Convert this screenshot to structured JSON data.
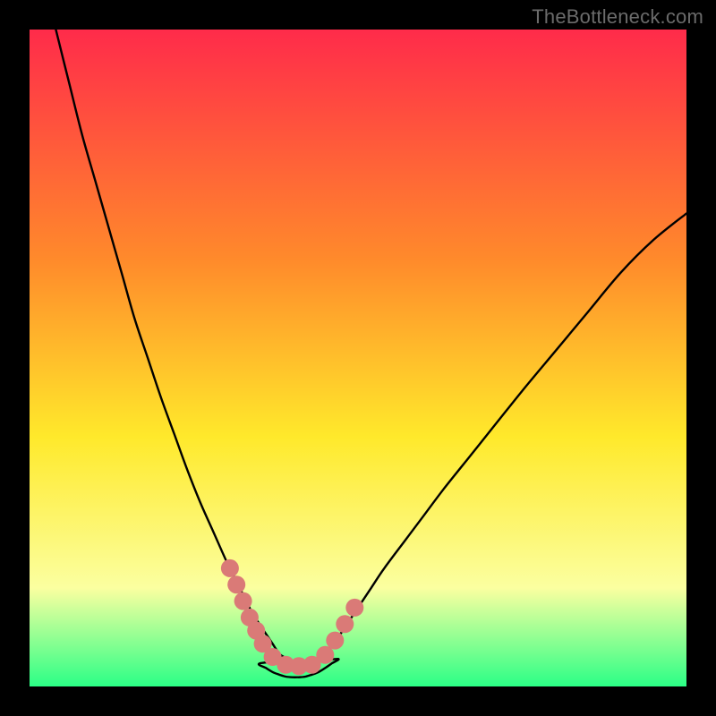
{
  "watermark": "TheBottleneck.com",
  "colors": {
    "frame": "#000000",
    "gradient_top": "#ff2b4a",
    "gradient_mid1": "#ff8a2b",
    "gradient_mid2": "#ffe92b",
    "gradient_low": "#fbffa0",
    "gradient_bottom": "#2bff86",
    "curve": "#000000",
    "marker": "#da7a77"
  },
  "chart_data": {
    "type": "line",
    "title": "",
    "xlabel": "",
    "ylabel": "",
    "xlim": [
      0,
      100
    ],
    "ylim": [
      0,
      100
    ],
    "series": [
      {
        "name": "left-branch",
        "x": [
          4,
          6,
          8,
          10,
          12,
          14,
          16,
          18,
          20,
          22,
          24,
          26,
          28,
          30,
          31,
          32,
          33,
          34,
          35,
          36,
          37,
          38,
          39
        ],
        "values": [
          100,
          92,
          84,
          77,
          70,
          63,
          56,
          50,
          44,
          38.5,
          33,
          28,
          23.5,
          19,
          17,
          15,
          13,
          11,
          9.5,
          8,
          6.5,
          5,
          4
        ]
      },
      {
        "name": "right-branch",
        "x": [
          44,
          45,
          46,
          47,
          48,
          50,
          52,
          54,
          57,
          60,
          63,
          67,
          71,
          75,
          80,
          85,
          90,
          95,
          100
        ],
        "values": [
          4,
          5,
          6.2,
          7.5,
          9,
          12,
          15,
          18,
          22,
          26,
          30,
          35,
          40,
          45,
          51,
          57,
          63,
          68,
          72
        ]
      },
      {
        "name": "valley-floor",
        "x": [
          35,
          36,
          37,
          38,
          39,
          40,
          41,
          42,
          43,
          44,
          45,
          46,
          47
        ],
        "values": [
          3.5,
          2.8,
          2.2,
          1.8,
          1.5,
          1.4,
          1.4,
          1.5,
          1.8,
          2.2,
          2.8,
          3.5,
          4.2
        ]
      }
    ],
    "markers": {
      "name": "highlight-dots",
      "color": "#da7a77",
      "points": [
        {
          "x": 30.5,
          "y": 18
        },
        {
          "x": 31.5,
          "y": 15.5
        },
        {
          "x": 32.5,
          "y": 13
        },
        {
          "x": 33.5,
          "y": 10.5
        },
        {
          "x": 34.5,
          "y": 8.5
        },
        {
          "x": 35.5,
          "y": 6.5
        },
        {
          "x": 37,
          "y": 4.5
        },
        {
          "x": 39,
          "y": 3.3
        },
        {
          "x": 41,
          "y": 3.1
        },
        {
          "x": 43,
          "y": 3.3
        },
        {
          "x": 45,
          "y": 4.8
        },
        {
          "x": 46.5,
          "y": 7
        },
        {
          "x": 48,
          "y": 9.5
        },
        {
          "x": 49.5,
          "y": 12
        }
      ]
    }
  }
}
